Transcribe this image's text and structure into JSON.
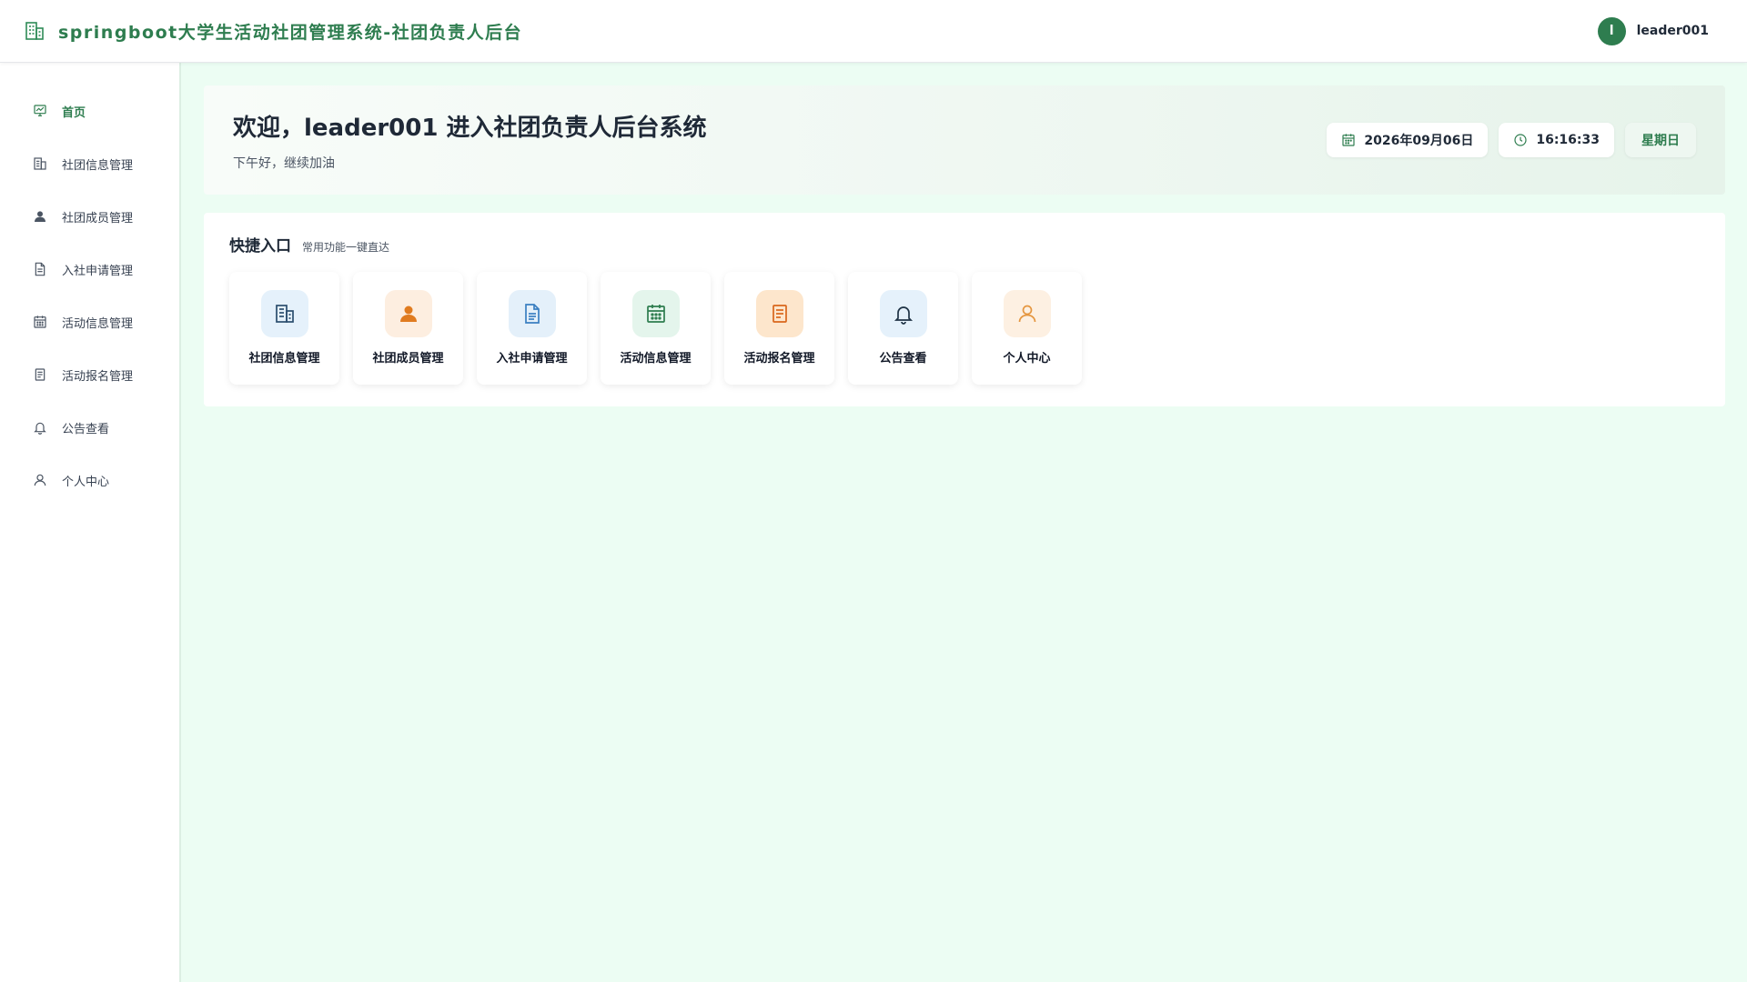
{
  "header": {
    "title": "springboot大学生活动社团管理系统-社团负责人后台",
    "avatar_initial": "l",
    "username": "leader001"
  },
  "sidebar": {
    "items": [
      {
        "label": "首页",
        "icon": "dashboard-icon",
        "active": true
      },
      {
        "label": "社团信息管理",
        "icon": "building-icon"
      },
      {
        "label": "社团成员管理",
        "icon": "user-filled-icon"
      },
      {
        "label": "入社申请管理",
        "icon": "document-icon"
      },
      {
        "label": "活动信息管理",
        "icon": "calendar-icon"
      },
      {
        "label": "活动报名管理",
        "icon": "form-icon"
      },
      {
        "label": "公告查看",
        "icon": "bell-icon"
      },
      {
        "label": "个人中心",
        "icon": "user-outline-icon"
      }
    ]
  },
  "welcome": {
    "title": "欢迎，leader001 进入社团负责人后台系统",
    "subtitle": "下午好，继续加油",
    "date": "2026年09月06日",
    "time": "16:16:33",
    "weekday": "星期日"
  },
  "quick": {
    "title": "快捷入口",
    "subtitle": "常用功能一键直达",
    "cards": [
      {
        "label": "社团信息管理",
        "icon": "building-icon"
      },
      {
        "label": "社团成员管理",
        "icon": "user-filled-icon"
      },
      {
        "label": "入社申请管理",
        "icon": "document-icon"
      },
      {
        "label": "活动信息管理",
        "icon": "calendar-icon"
      },
      {
        "label": "活动报名管理",
        "icon": "form-icon"
      },
      {
        "label": "公告查看",
        "icon": "bell-icon"
      },
      {
        "label": "个人中心",
        "icon": "user-outline-icon"
      }
    ]
  },
  "colors": {
    "primary": "#2e7d4f",
    "background": "#ecfdf3"
  }
}
